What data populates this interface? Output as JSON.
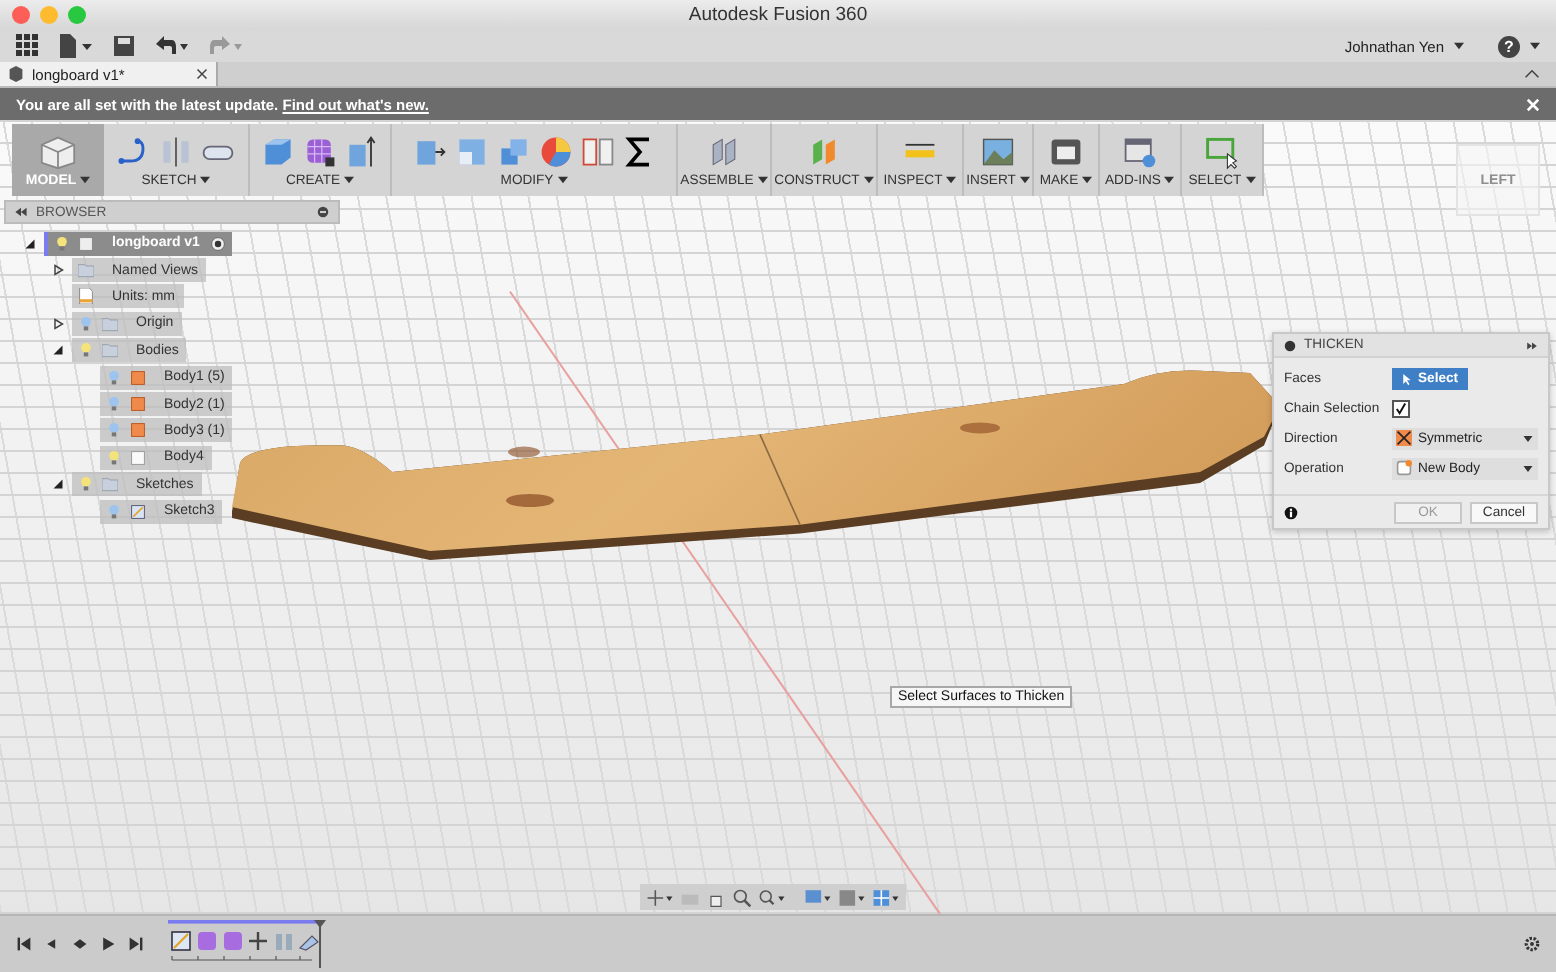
{
  "window": {
    "title": "Autodesk Fusion 360"
  },
  "app_toolbar": {
    "user": "Johnathan Yen",
    "help": "?"
  },
  "document_tabs": [
    {
      "label": "longboard v1*",
      "selected": true
    }
  ],
  "notification": {
    "text": "You are all set with the latest update.",
    "link": "Find out what's new."
  },
  "ribbon": {
    "workspace": {
      "label": "MODEL",
      "selected": true
    },
    "groups": [
      {
        "label": "SKETCH"
      },
      {
        "label": "CREATE"
      },
      {
        "label": "MODIFY"
      },
      {
        "label": "ASSEMBLE"
      },
      {
        "label": "CONSTRUCT"
      },
      {
        "label": "INSPECT"
      },
      {
        "label": "INSERT"
      },
      {
        "label": "MAKE"
      },
      {
        "label": "ADD-INS"
      },
      {
        "label": "SELECT"
      }
    ]
  },
  "view_cube": {
    "label": "LEFT"
  },
  "browser": {
    "title": "BROWSER",
    "tree": [
      {
        "label": "longboard v1",
        "kind": "document",
        "active": true,
        "expanded": true,
        "children": [
          {
            "label": "Named Views",
            "kind": "views",
            "active": false,
            "expanded": false
          },
          {
            "label": "Units: mm",
            "kind": "units",
            "active": false
          },
          {
            "label": "Origin",
            "kind": "folder",
            "active": false,
            "expanded": false
          },
          {
            "label": "Bodies",
            "kind": "folder",
            "active": false,
            "expanded": true,
            "children": [
              {
                "label": "Body1 (5)",
                "kind": "body",
                "active": false
              },
              {
                "label": "Body2 (1)",
                "kind": "body",
                "active": false
              },
              {
                "label": "Body3 (1)",
                "kind": "body",
                "active": false
              },
              {
                "label": "Body4",
                "kind": "surface",
                "active": false
              }
            ]
          },
          {
            "label": "Sketches",
            "kind": "folder",
            "active": false,
            "expanded": true,
            "children": [
              {
                "label": "Sketch3",
                "kind": "sketch",
                "active": false
              }
            ]
          }
        ]
      }
    ]
  },
  "thicken_dialog": {
    "title": "THICKEN",
    "rows": [
      {
        "label": "Faces",
        "kind": "select",
        "value": "Select",
        "selected": true
      },
      {
        "label": "Chain Selection",
        "kind": "checkbox",
        "checked": true
      },
      {
        "label": "Direction",
        "kind": "dropdown",
        "value": "Symmetric"
      },
      {
        "label": "Operation",
        "kind": "dropdown",
        "value": "New Body"
      }
    ],
    "buttons": [
      {
        "label": "OK",
        "disabled": true
      },
      {
        "label": "Cancel",
        "disabled": false
      }
    ]
  },
  "tooltip": "Select Surfaces to Thicken"
}
